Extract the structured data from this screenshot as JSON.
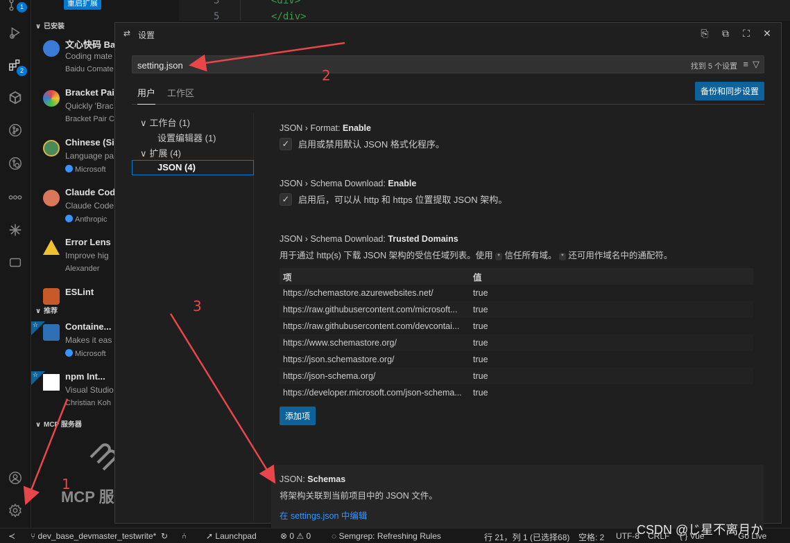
{
  "sidebar": {
    "restart_label": "重启扩展",
    "installed_title": "已安装",
    "recommended_title": "推荐",
    "mcp_title": "MCP 服务器",
    "mcp_big_text": "MCP 服",
    "installed": [
      {
        "name": "文心快码 Ba",
        "desc": "Coding mate",
        "publisher": "Baidu Comate",
        "verified": false
      },
      {
        "name": "Bracket Pair",
        "desc": "Quickly 'Brac",
        "publisher": "Bracket Pair C",
        "verified": false
      },
      {
        "name": "Chinese (Sir",
        "desc": "Language pa",
        "publisher": "Microsoft",
        "verified": true
      },
      {
        "name": "Claude Cod",
        "desc": "Claude Code",
        "publisher": "Anthropic",
        "verified": true
      },
      {
        "name": "Error Lens",
        "desc": "Improve hig",
        "publisher": "Alexander",
        "verified": false
      },
      {
        "name": "ESLint",
        "desc": "",
        "publisher": "",
        "verified": false
      }
    ],
    "recommended": [
      {
        "name": "Containe...",
        "desc": "Makes it eas",
        "publisher": "Microsoft",
        "verified": true
      },
      {
        "name": "npm Int...",
        "desc": "Visual Studio",
        "publisher": "Christian Koh",
        "verified": false
      }
    ]
  },
  "editor": {
    "line_numbers": [
      "3",
      "5"
    ],
    "lines": [
      "<div>",
      "</div>"
    ]
  },
  "dialog": {
    "title": "设置",
    "search": {
      "value": "setting.json",
      "result": "找到 5 个设置"
    },
    "tabs": [
      "用户",
      "工作区"
    ],
    "sync_button": "备份和同步设置",
    "toc": [
      {
        "label": "工作台 (1)",
        "chev": "∨"
      },
      {
        "label": "设置编辑器 (1)",
        "chev": ""
      },
      {
        "label": "扩展 (4)",
        "chev": "∨"
      },
      {
        "label": "JSON (4)",
        "chev": ""
      }
    ],
    "settings": {
      "format": {
        "prefix": "JSON › Format: ",
        "name": "Enable",
        "label": "启用或禁用默认 JSON 格式化程序。"
      },
      "schema_download": {
        "prefix": "JSON › Schema Download: ",
        "name": "Enable",
        "label": "启用后，可以从 http 和 https 位置提取 JSON 架构。"
      },
      "trusted_domains": {
        "prefix": "JSON › Schema Download: ",
        "name": "Trusted Domains",
        "desc_a": "用于通过 http(s) 下载 JSON 架构的受信任域列表。使用",
        "desc_b": "信任所有域。",
        "desc_c": "还可用作域名中的通配符。",
        "pill": "*",
        "col_key": "项",
        "col_val": "值",
        "rows": [
          {
            "key": "https://schemastore.azurewebsites.net/",
            "val": "true"
          },
          {
            "key": "https://raw.githubusercontent.com/microsoft...",
            "val": "true"
          },
          {
            "key": "https://raw.githubusercontent.com/devcontai...",
            "val": "true"
          },
          {
            "key": "https://www.schemastore.org/",
            "val": "true"
          },
          {
            "key": "https://json.schemastore.org/",
            "val": "true"
          },
          {
            "key": "https://json-schema.org/",
            "val": "true"
          },
          {
            "key": "https://developer.microsoft.com/json-schema...",
            "val": "true"
          }
        ],
        "add_button": "添加项"
      },
      "schemas": {
        "prefix": "JSON: ",
        "name": "Schemas",
        "desc": "将架构关联到当前项目中的 JSON 文件。",
        "link": "在 settings.json 中编辑"
      }
    }
  },
  "statusbar": {
    "branch": "dev_base_devmaster_testwrite*",
    "launchpad": "Launchpad",
    "problems": "⊗ 0 ⚠ 0",
    "semgrep": "Semgrep: Refreshing Rules",
    "cursor": "行 21，列 1 (已选择68)",
    "spaces": "空格: 2",
    "encoding": "UTF-8",
    "eol": "CRLF",
    "lang": "{ } Vue",
    "golive": "Go Live"
  },
  "annotations": [
    "1",
    "2",
    "3"
  ],
  "watermark": "CSDN @じ星不离月か",
  "colors": {
    "accent": "#0078d4",
    "button": "#0e639c",
    "annotation": "#e8464a",
    "link": "#3794ff"
  }
}
